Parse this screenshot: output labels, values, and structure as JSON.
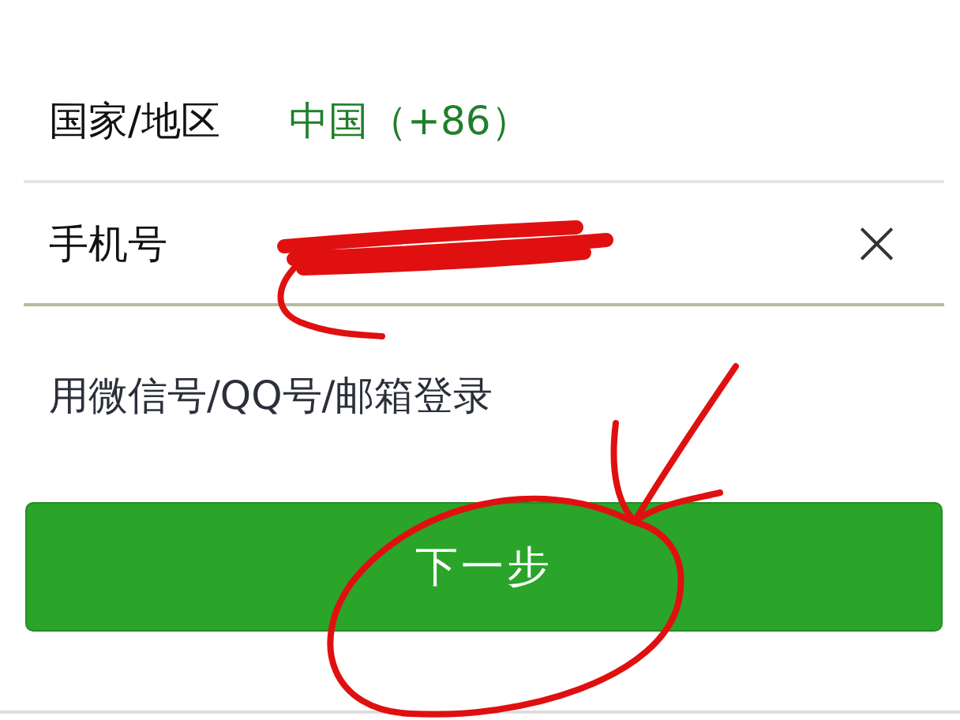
{
  "region_row": {
    "label": "国家/地区",
    "value": "中国（+86）"
  },
  "phone_row": {
    "label": "手机号",
    "clear_icon": "×"
  },
  "alt_login_link": "用微信号/QQ号/邮箱登录",
  "next_button": "下一步",
  "annotations": [
    {
      "kind": "scribble"
    },
    {
      "kind": "arrow"
    },
    {
      "kind": "circle"
    }
  ]
}
